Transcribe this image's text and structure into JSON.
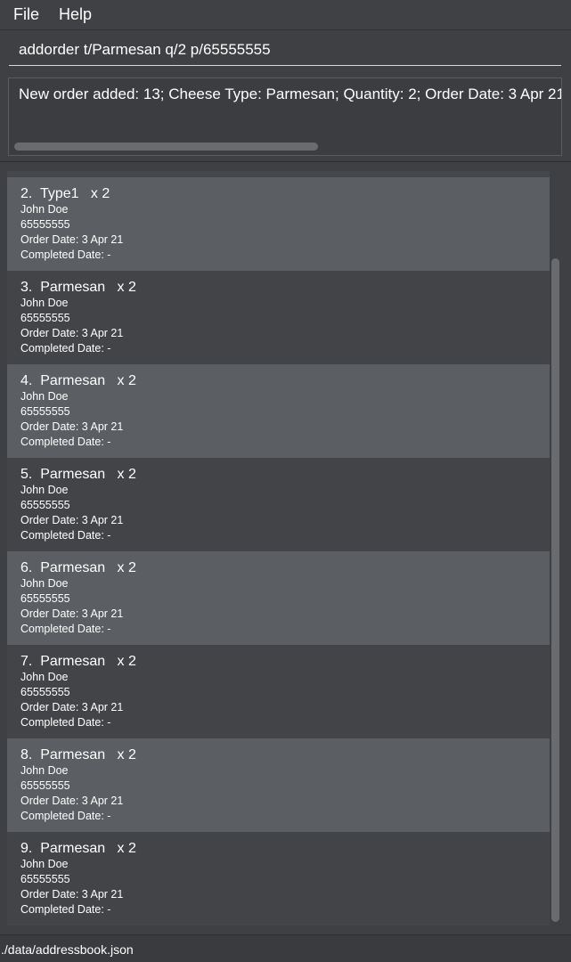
{
  "menu": {
    "file": "File",
    "help": "Help"
  },
  "command": {
    "value": "addorder t/Parmesan q/2 p/65555555"
  },
  "result": {
    "text": "New order added: 13; Cheese Type: Parmesan; Quantity: 2; Order Date: 3 Apr 21"
  },
  "orders": [
    {
      "title": "2.  Type1   x 2",
      "name": "John Doe",
      "phone": "65555555",
      "order_date": "Order Date: 3 Apr 21",
      "completed_date": "Completed Date: -"
    },
    {
      "title": "3.  Parmesan   x 2",
      "name": "John Doe",
      "phone": "65555555",
      "order_date": "Order Date: 3 Apr 21",
      "completed_date": "Completed Date: -"
    },
    {
      "title": "4.  Parmesan   x 2",
      "name": "John Doe",
      "phone": "65555555",
      "order_date": "Order Date: 3 Apr 21",
      "completed_date": "Completed Date: -"
    },
    {
      "title": "5.  Parmesan   x 2",
      "name": "John Doe",
      "phone": "65555555",
      "order_date": "Order Date: 3 Apr 21",
      "completed_date": "Completed Date: -"
    },
    {
      "title": "6.  Parmesan   x 2",
      "name": "John Doe",
      "phone": "65555555",
      "order_date": "Order Date: 3 Apr 21",
      "completed_date": "Completed Date: -"
    },
    {
      "title": "7.  Parmesan   x 2",
      "name": "John Doe",
      "phone": "65555555",
      "order_date": "Order Date: 3 Apr 21",
      "completed_date": "Completed Date: -"
    },
    {
      "title": "8.  Parmesan   x 2",
      "name": "John Doe",
      "phone": "65555555",
      "order_date": "Order Date: 3 Apr 21",
      "completed_date": "Completed Date: -"
    },
    {
      "title": "9.  Parmesan   x 2",
      "name": "John Doe",
      "phone": "65555555",
      "order_date": "Order Date: 3 Apr 21",
      "completed_date": "Completed Date: -"
    }
  ],
  "status": {
    "path": "./data/addressbook.json"
  },
  "colors": {
    "background": "#3f4043",
    "card_light": "#5b5e62",
    "card_dark": "#434447",
    "text": "#ffffff"
  }
}
